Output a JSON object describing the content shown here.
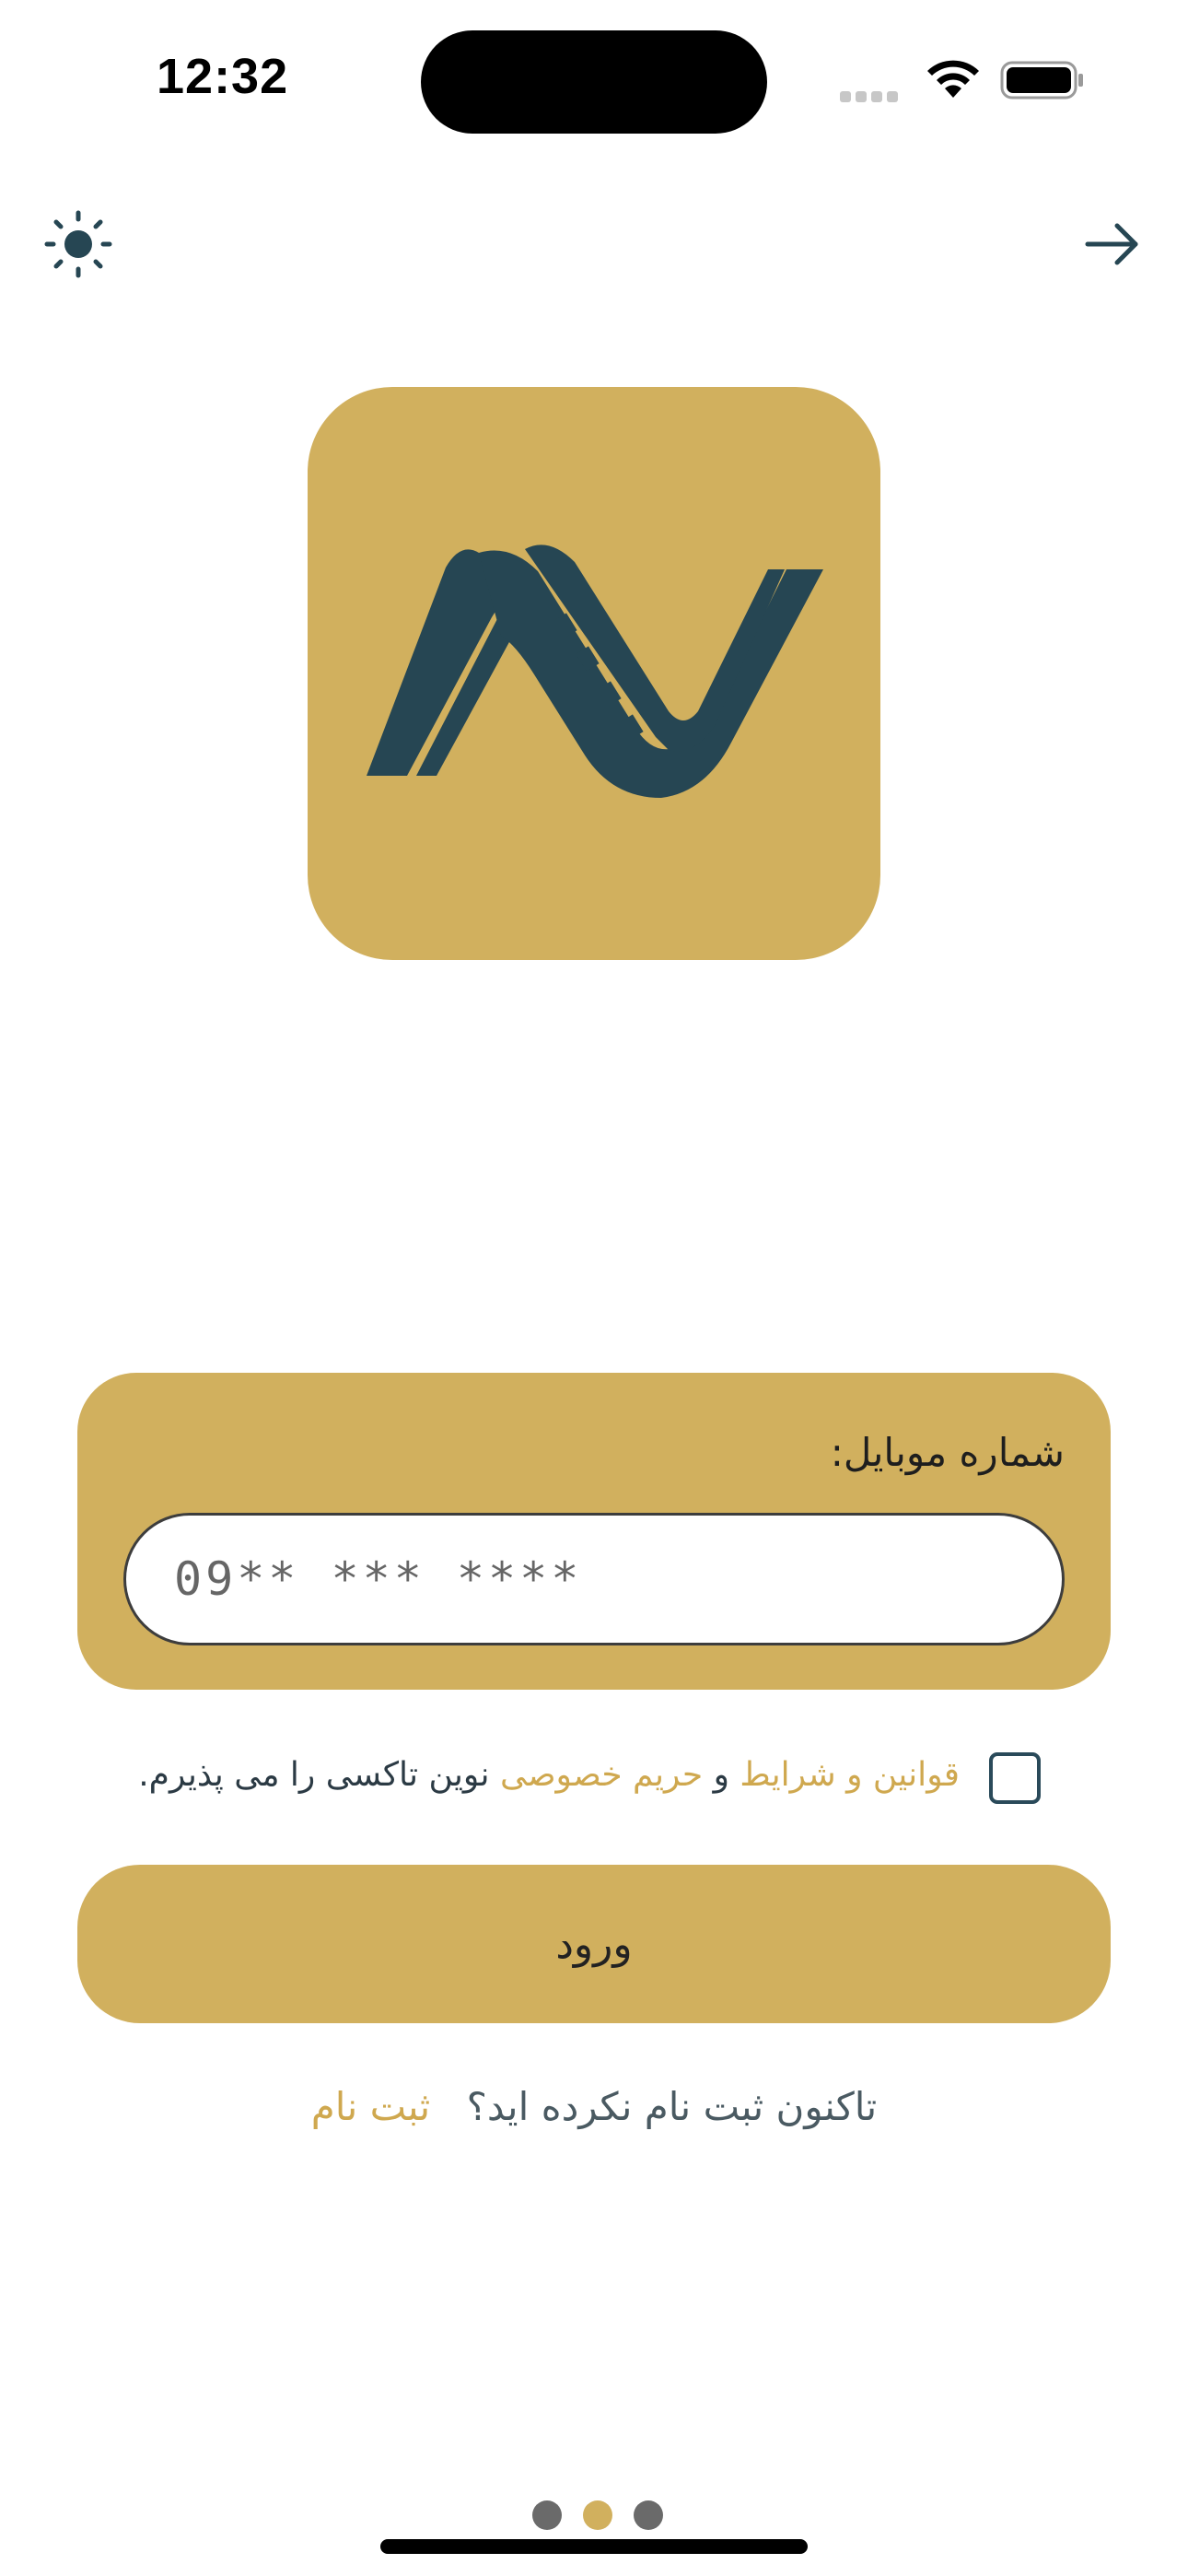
{
  "status_bar": {
    "time": "12:32"
  },
  "colors": {
    "accent": "#d1b05e",
    "dark_teal": "#264653",
    "link": "#cfa84f"
  },
  "nav": {
    "theme_icon": "sun-icon",
    "back_icon": "arrow-right-icon"
  },
  "login_form": {
    "phone_label": "شماره موبایل:",
    "phone_placeholder": "09** *** ****"
  },
  "terms": {
    "link_terms": "قوانین و شرایط",
    "conjunction": " و ",
    "link_privacy": "حریم خصوصی",
    "rest": " نوین تاکسی را می پذیرم."
  },
  "login_button": {
    "label": "ورود"
  },
  "signup": {
    "question": "تاکنون ثبت نام نکرده اید؟",
    "link": "ثبت نام"
  },
  "pager": {
    "count": 3,
    "active_index": 1
  }
}
